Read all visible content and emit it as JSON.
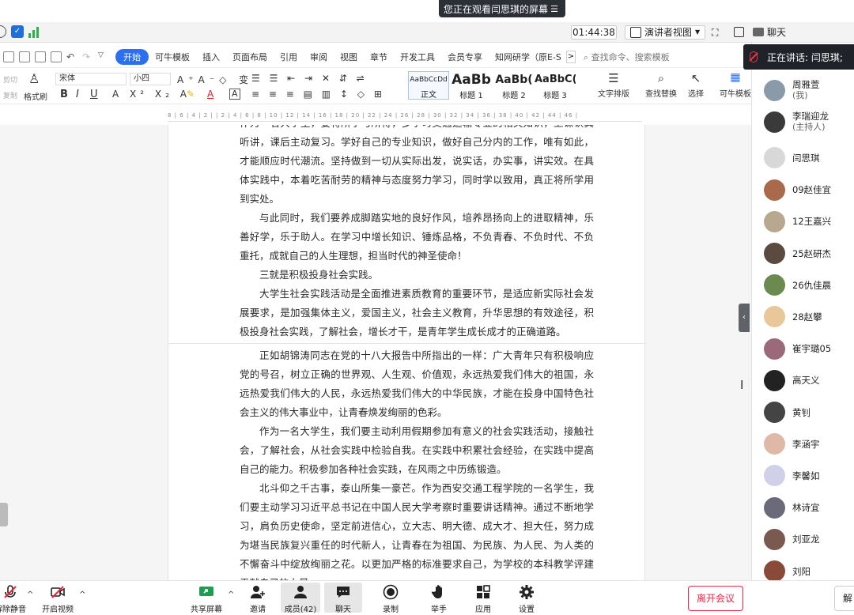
{
  "banner": {
    "text": "您正在观看闫思琪的屏幕",
    "menu_icon": "menu-icon"
  },
  "meeting_top": {
    "timer": "01:44:38",
    "presenter_view": "演讲者视图",
    "chat_tab": "聊天"
  },
  "speaking": {
    "text": "正在讲话: 闫思琪;"
  },
  "wps": {
    "tabs": [
      "开始",
      "可牛模板",
      "插入",
      "页面布局",
      "引用",
      "审阅",
      "视图",
      "章节",
      "开发工具",
      "会员专享",
      "知网研学（原E-S"
    ],
    "tab_more": ">",
    "search_placeholder": "查找命令、搜索模板",
    "ribbon": {
      "cut": "剪切",
      "copy": "复制",
      "format_painter": "格式刷",
      "font": "宋体",
      "size": "小四",
      "styles": [
        {
          "preview": "AaBbCcDd",
          "label": "正文"
        },
        {
          "preview": "AaBb",
          "label": "标题 1"
        },
        {
          "preview": "AaBb(",
          "label": "标题 2"
        },
        {
          "preview": "AaBbC(",
          "label": "标题 3"
        }
      ],
      "text_layout": "文字排版",
      "find_replace": "查找替换",
      "select": "选择",
      "template": "可牛模板"
    },
    "ruler_text": "8 | 6 | 4 | 2 | | 2 | 4 | 6 | 8 | 10 | 12 | 14 | 16 | 18 | 20 | 22 | 24 | 26 | 28 | 30 | 32 | 34 | 36 | 38 | 40 | 42 | 44 | 46 |"
  },
  "document": {
    "paragraphs": [
      {
        "text": "作为一名大学生，要将所学与所得，多学习交通运输专业的相关知识，上课认真听讲，课后主动复习。学好自己的专业知识，做好自己分内的工作，唯有如此，才能顺应时代潮流。坚持做到一切从实际出发，说实话，办实事，讲实效。在具体实践中，本着吃苦耐劳的精神与态度努力学习，同时学以致用，真正将所学用到实处。",
        "indent": false
      },
      {
        "text": "与此同时，我们要养成脚踏实地的良好作风，培养昂扬向上的进取精神，乐善好学，乐于助人。在学习中增长知识、锤炼品格，不负青春、不负时代、不负重托，成就自己的人生理想，担当时代的神圣使命！",
        "indent": true
      },
      {
        "text": "三就是积极投身社会实践。",
        "indent": true
      },
      {
        "text": "大学生社会实践活动是全面推进素质教育的重要环节，是适应新实际社会发展要求，是加强集体主义，爱国主义，社会主义教育，升华思想的有效途径，积极投身社会实践，了解社会，增长才干，是青年学生成长成才的正确道路。",
        "indent": true
      },
      {
        "text": "正如胡锦涛同志在党的十八大报告中所指出的一样：广大青年只有积极响应党的号召，树立正确的世界观、人生观、价值观，永远热爱我们伟大的祖国，永远热爱我们伟大的人民，永远热爱我们伟大的中华民族，才能在投身中国特色社会主义的伟大事业中，让青春焕发绚丽的色彩。",
        "indent": true
      },
      {
        "text": "作为一名大学生，我们要主动利用假期参加有意义的社会实践活动，接触社会，了解社会，从社会实践中检验自我。在实践中积累社会经验，在实践中提高自己的能力。积极参加各种社会实践，在风雨之中历练锻造。",
        "indent": true
      },
      {
        "text": "北斗仰之千古事，泰山所集一豪芒。作为西安交通工程学院的一名学生，我们要主动学习习近平总书记在中国人民大学考察时重要讲话精神。通过不断地学习，肩负历史使命，坚定前进信心，立大志、明大德、成大才、担大任，努力成为堪当民族复兴重任的时代新人，让青春在为祖国、为民族、为人民、为人类的不懈奋斗中绽放绚丽之花。以更加严格的标准要求自己，为学校的本科教学评建贡献自己的力量",
        "indent": true
      }
    ]
  },
  "members": [
    {
      "name": "周雅萱",
      "role": "(我)",
      "color": "#8a9aa8"
    },
    {
      "name": "李瑞迎龙",
      "role": "(主持人)",
      "color": "#3a3a3a"
    },
    {
      "name": "闫思琪",
      "role": "",
      "color": "#d8d8d8"
    },
    {
      "name": "09赵佳宜",
      "role": "",
      "color": "#a86a4a"
    },
    {
      "name": "12王嘉兴",
      "role": "",
      "color": "#b8a890"
    },
    {
      "name": "25赵研杰",
      "role": "",
      "color": "#5a4a40"
    },
    {
      "name": "26仇佳晨",
      "role": "",
      "color": "#6a8a50"
    },
    {
      "name": "28赵攀",
      "role": "",
      "color": "#e8c898"
    },
    {
      "name": "崔宇璐05",
      "role": "",
      "color": "#9a6a7a"
    },
    {
      "name": "高天义",
      "role": "",
      "color": "#222222"
    },
    {
      "name": "黄钊",
      "role": "",
      "color": "#444444"
    },
    {
      "name": "李涵宇",
      "role": "",
      "color": "#e0b8a8"
    },
    {
      "name": "李馨如",
      "role": "",
      "color": "#d0d0e8"
    },
    {
      "name": "林诗宜",
      "role": "",
      "color": "#6a6a7a"
    },
    {
      "name": "刘亚龙",
      "role": "",
      "color": "#7a5a50"
    },
    {
      "name": "刘阳",
      "role": "",
      "color": "#8a4a3a"
    }
  ],
  "bottom": {
    "mute": "解除静音",
    "video": "开启视频",
    "share": "共享屏幕",
    "invite": "邀请",
    "members": "成员(42)",
    "chat": "聊天",
    "record": "录制",
    "raise_hand": "举手",
    "apps": "应用",
    "settings": "设置",
    "leave": "离开会议",
    "right_btn": "解"
  }
}
